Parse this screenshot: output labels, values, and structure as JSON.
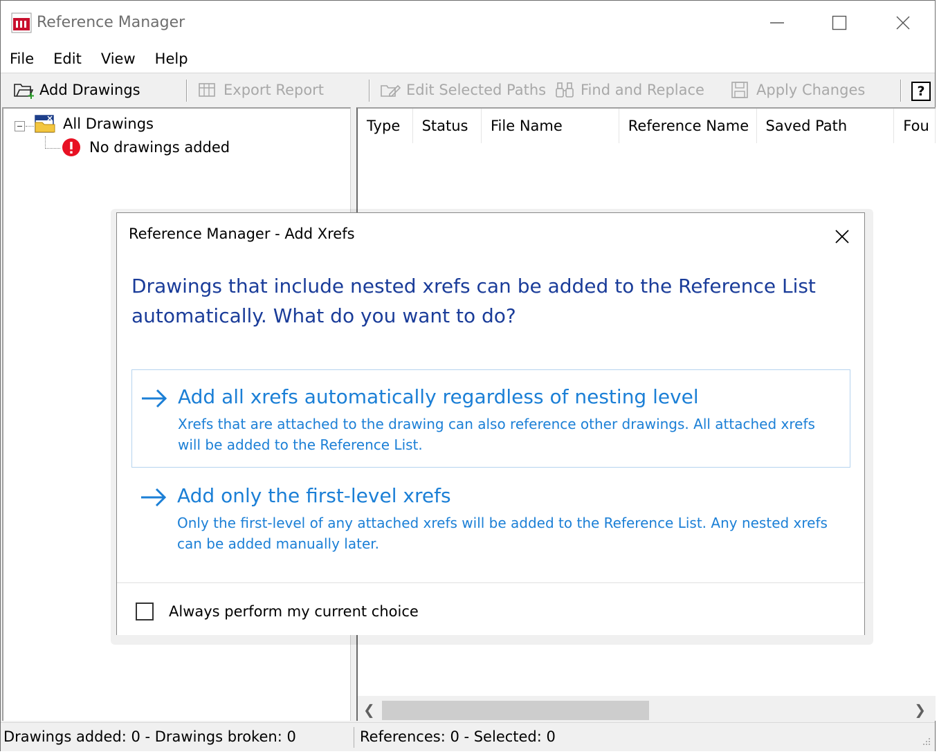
{
  "window": {
    "title": "Reference Manager"
  },
  "menu": [
    "File",
    "Edit",
    "View",
    "Help"
  ],
  "toolbar": {
    "add_drawings": "Add Drawings",
    "export_report": "Export Report",
    "edit_selected_paths": "Edit Selected Paths",
    "find_and_replace": "Find and Replace",
    "apply_changes": "Apply Changes",
    "help": "?"
  },
  "tree": {
    "root_label": "All Drawings",
    "child_label": "No drawings added"
  },
  "list": {
    "columns": [
      "Type",
      "Status",
      "File Name",
      "Reference Name",
      "Saved Path",
      "Fou"
    ]
  },
  "status": {
    "left": "Drawings added: 0  -  Drawings broken: 0",
    "right": "References: 0  -  Selected: 0"
  },
  "dialog": {
    "title": "Reference Manager - Add Xrefs",
    "instruction": "Drawings that include nested xrefs can be added to the Reference List automatically. What do you want to do?",
    "option1": {
      "title": "Add all xrefs automatically regardless of nesting level",
      "description": "Xrefs that are attached to the drawing can also reference other drawings. All attached xrefs will be added to the Reference List."
    },
    "option2": {
      "title": "Add only the first-level xrefs",
      "description": "Only the first-level of any attached xrefs will be added to the Reference List.  Any nested xrefs can be added manually later."
    },
    "checkbox_label": "Always perform my current choice"
  },
  "colors": {
    "instruction": "#1a3c99",
    "command_link": "#1b7fd6",
    "error": "#e81123"
  }
}
